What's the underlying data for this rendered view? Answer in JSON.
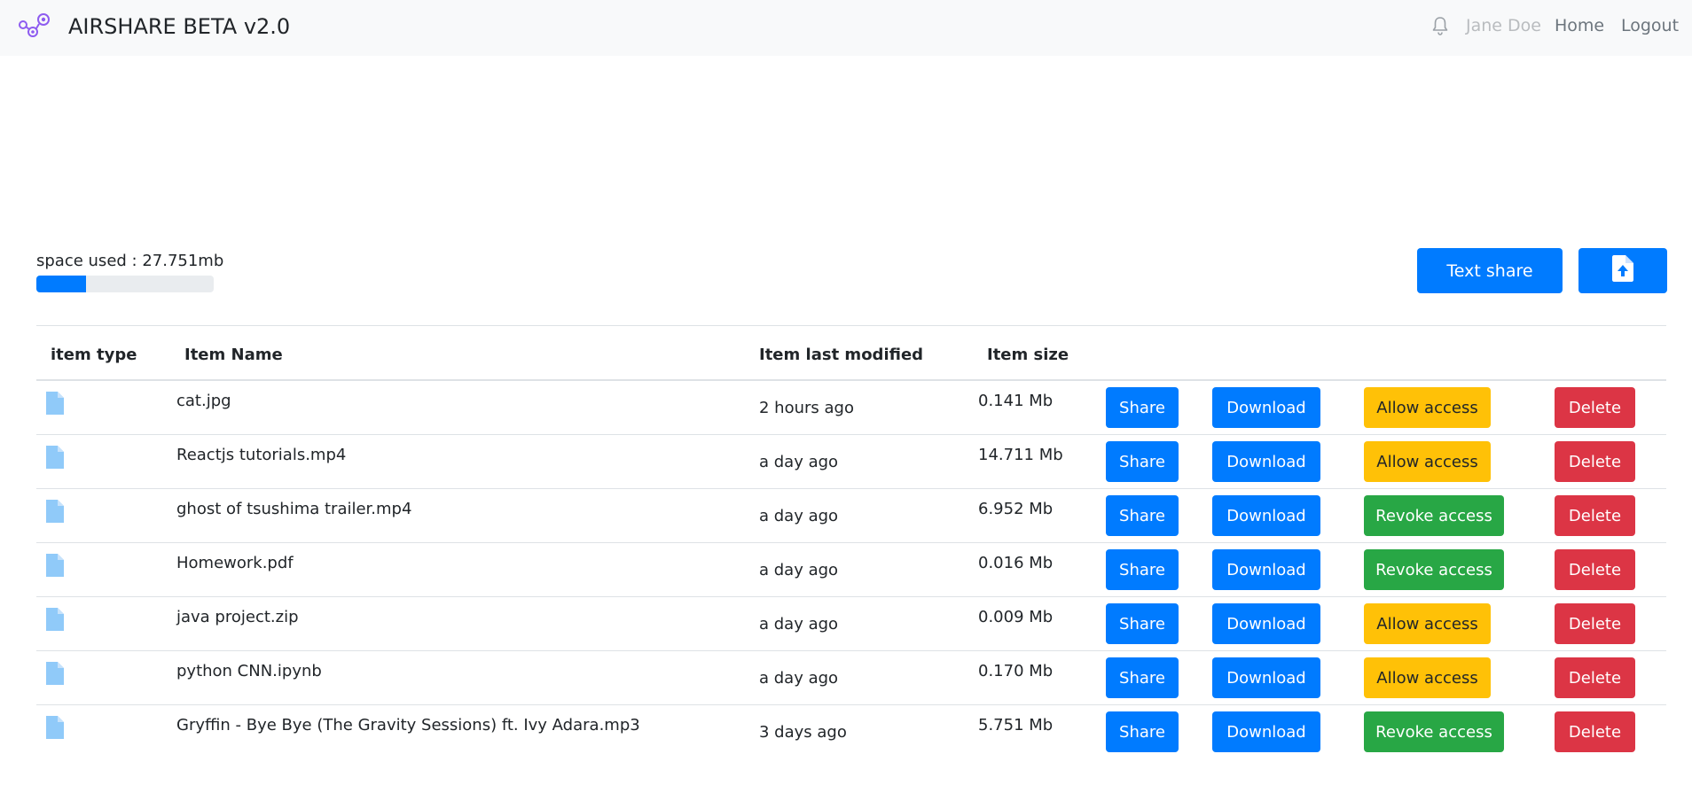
{
  "navbar": {
    "brand_title": "AIRSHARE BETA v2.0",
    "user_name": "Jane Doe",
    "home_label": "Home",
    "logout_label": "Logout"
  },
  "storage": {
    "space_used_label": "space used : 27.751mb",
    "progress_fraction": 0.28
  },
  "actions": {
    "text_share_label": "Text share",
    "upload_icon": "file-upload-icon"
  },
  "table": {
    "headers": [
      "item type",
      "Item Name",
      "Item last modified",
      "Item size"
    ],
    "rows": [
      {
        "type_icon": "file-icon",
        "name": "cat.jpg",
        "modified": "2 hours ago",
        "size": "0.141 Mb",
        "share": "Share",
        "download": "Download",
        "access": "Allow access",
        "access_state": "allow",
        "delete": "Delete"
      },
      {
        "type_icon": "file-icon",
        "name": "Reactjs tutorials.mp4",
        "modified": "a day ago",
        "size": "14.711 Mb",
        "share": "Share",
        "download": "Download",
        "access": "Allow access",
        "access_state": "allow",
        "delete": "Delete"
      },
      {
        "type_icon": "file-icon",
        "name": "ghost of tsushima trailer.mp4",
        "modified": "a day ago",
        "size": "6.952 Mb",
        "share": "Share",
        "download": "Download",
        "access": "Revoke access",
        "access_state": "revoke",
        "delete": "Delete"
      },
      {
        "type_icon": "file-icon",
        "name": "Homework.pdf",
        "modified": "a day ago",
        "size": "0.016 Mb",
        "share": "Share",
        "download": "Download",
        "access": "Revoke access",
        "access_state": "revoke",
        "delete": "Delete"
      },
      {
        "type_icon": "file-icon",
        "name": "java project.zip",
        "modified": "a day ago",
        "size": "0.009 Mb",
        "share": "Share",
        "download": "Download",
        "access": "Allow access",
        "access_state": "allow",
        "delete": "Delete"
      },
      {
        "type_icon": "file-icon",
        "name": "python CNN.ipynb",
        "modified": "a day ago",
        "size": "0.170 Mb",
        "share": "Share",
        "download": "Download",
        "access": "Allow access",
        "access_state": "allow",
        "delete": "Delete"
      },
      {
        "type_icon": "file-icon",
        "name": "Gryffin - Bye Bye (The Gravity Sessions) ft. Ivy Adara.mp3",
        "modified": "3 days ago",
        "size": "5.751 Mb",
        "share": "Share",
        "download": "Download",
        "access": "Revoke access",
        "access_state": "revoke",
        "delete": "Delete"
      }
    ]
  },
  "colors": {
    "primary": "#007bff",
    "success": "#28a745",
    "warning": "#ffc107",
    "danger": "#dc3545",
    "file_icon": "#90caf9",
    "logo": "#8e5cf0"
  }
}
